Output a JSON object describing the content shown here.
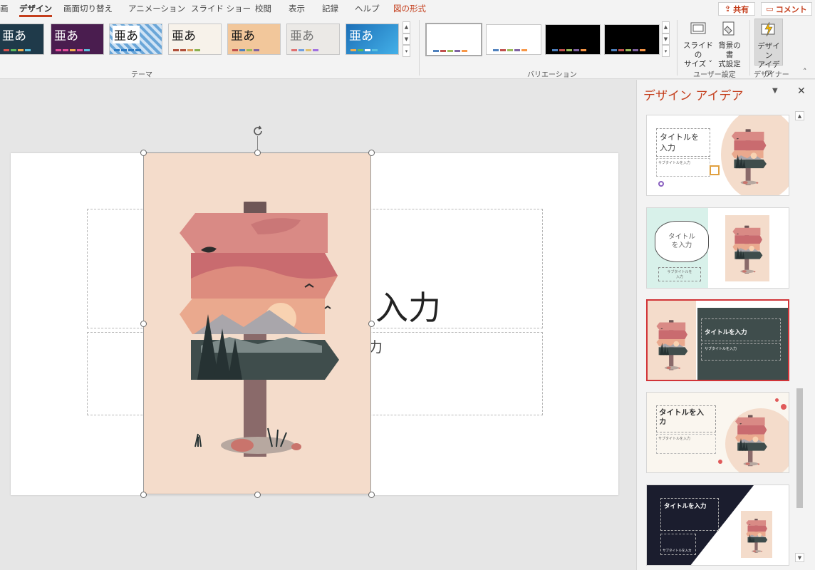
{
  "ribbon_tabs": {
    "t0": "画",
    "t1": "デザイン",
    "t2": "画面切り替え",
    "t3": "アニメーション",
    "t4": "スライド ショー",
    "t5": "校閲",
    "t6": "表示",
    "t7": "記録",
    "t8": "ヘルプ",
    "t9": "図の形式"
  },
  "top_right": {
    "share": "共有",
    "comment": "コメント"
  },
  "themes": {
    "glyph": "亜あ",
    "group_label": "テーマ"
  },
  "variations": {
    "group_label": "バリエーション"
  },
  "customize": {
    "slide_size_l1": "スライドの",
    "slide_size_l2": "サイズ ˅",
    "bg_format_l1": "背景の書",
    "bg_format_l2": "式設定",
    "group_label": "ユーザー設定"
  },
  "designer": {
    "btn_l1": "デザイン",
    "btn_l2": "アイデア",
    "group_label": "デザイナー"
  },
  "slide": {
    "title_fragment": "入力",
    "subtitle_fragment": "力"
  },
  "design_pane": {
    "title": "デザイン アイデア",
    "ideas": {
      "i1_title_l1": "タイトルを",
      "i1_title_l2": "入力",
      "i1_sub": "サブタイトルを入力",
      "i2_title_l1": "タイトル",
      "i2_title_l2": "を入力",
      "i2_sub_l1": "サブタイトルを",
      "i2_sub_l2": "入力",
      "i3_title": "タイトルを入力",
      "i3_sub": "サブタイトルを入力",
      "i4_title_l1": "タイトルを入",
      "i4_title_l2": "カ",
      "i4_sub": "サブタイトルを入力",
      "i5_title": "タイトルを入力",
      "i5_sub": "サブタイトルを入力"
    }
  },
  "colors": {
    "accent": "#c43e1c",
    "selected_idea_border": "#d13438",
    "picture_bg": "#f4dccb",
    "sign_dark": "#3f4d4c",
    "sign_pink": "#c96b6f"
  }
}
